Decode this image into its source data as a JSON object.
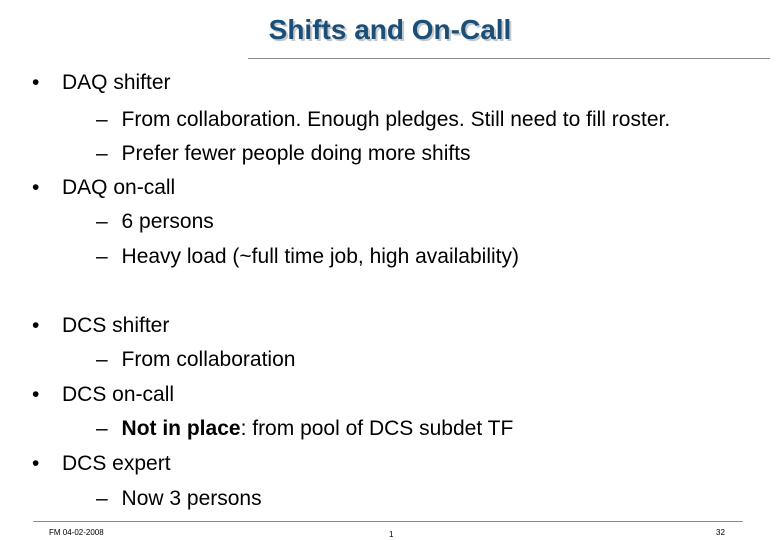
{
  "slide": {
    "title": "Shifts and On-Call",
    "bullet_glyph": "•",
    "dash_glyph": "–",
    "items": [
      {
        "text": "DAQ shifter",
        "subitems": [
          {
            "text": "From collaboration. Enough pledges. Still need to fill roster."
          },
          {
            "text": "Prefer fewer people doing more shifts"
          }
        ]
      },
      {
        "text": "DAQ on-call",
        "subitems": [
          {
            "text": "6 persons"
          },
          {
            "text": "Heavy load (~full time job, high availability)"
          }
        ]
      },
      {
        "text": "DCS shifter",
        "subitems": [
          {
            "text": "From collaboration"
          }
        ]
      },
      {
        "text": "DCS on-call",
        "subitems": [
          {
            "bold": "Not in place",
            "text": ": from pool of DCS subdet TF"
          }
        ]
      },
      {
        "text": "DCS expert",
        "subitems": [
          {
            "text": "Now 3 persons"
          }
        ]
      }
    ]
  },
  "footer": {
    "left": "FM 04-02-2008",
    "center": "1",
    "right": "32"
  },
  "colors": {
    "title": "#1a4f7a",
    "rule": "#8a8a8a"
  }
}
